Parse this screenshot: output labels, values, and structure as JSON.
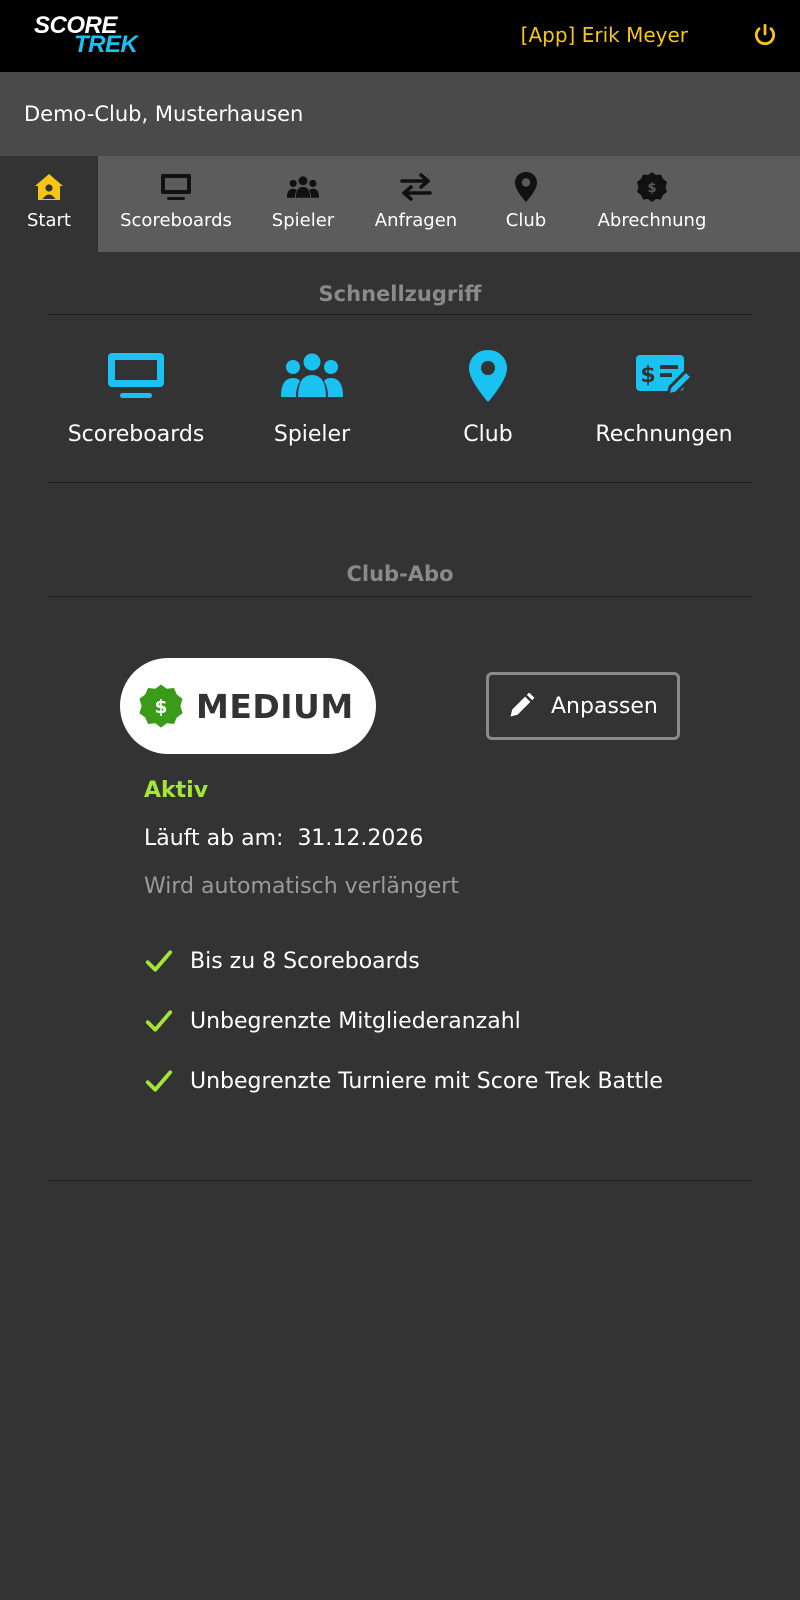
{
  "header": {
    "logo_line1": "SCORE",
    "logo_line2": "TREK",
    "user_label": "[App] Erik Meyer",
    "power_icon": "power-icon"
  },
  "club": {
    "name": "Demo-Club, Musterhausen"
  },
  "nav": {
    "tabs": [
      {
        "label": "Start",
        "icon": "home-user-icon",
        "active": true
      },
      {
        "label": "Scoreboards",
        "icon": "monitor-icon"
      },
      {
        "label": "Spieler",
        "icon": "users-icon"
      },
      {
        "label": "Anfragen",
        "icon": "swap-arrows-icon"
      },
      {
        "label": "Club",
        "icon": "map-pin-icon"
      },
      {
        "label": "Abrechnung",
        "icon": "dollar-badge-icon"
      }
    ]
  },
  "quick_access": {
    "title": "Schnellzugriff",
    "items": [
      {
        "label": "Scoreboards",
        "icon": "monitor-icon"
      },
      {
        "label": "Spieler",
        "icon": "users-icon"
      },
      {
        "label": "Club",
        "icon": "map-pin-icon"
      },
      {
        "label": "Rechnungen",
        "icon": "invoice-edit-icon"
      }
    ]
  },
  "subscription": {
    "title": "Club-Abo",
    "plan_name": "MEDIUM",
    "edit_label": "Anpassen",
    "status": "Aktiv",
    "expiry_label": "Läuft ab am:",
    "expiry_date": "31.12.2026",
    "renewal_note": "Wird automatisch verlängert",
    "features": [
      "Bis zu 8 Scoreboards",
      "Unbegrenzte Mitgliederanzahl",
      "Unbegrenzte Turniere mit Score Trek Battle"
    ]
  },
  "colors": {
    "background": "#333333",
    "accent_blue": "#19c2f0",
    "accent_yellow": "#f5c518",
    "active_green": "#a3e635",
    "badge_green": "#3a9a1a"
  }
}
